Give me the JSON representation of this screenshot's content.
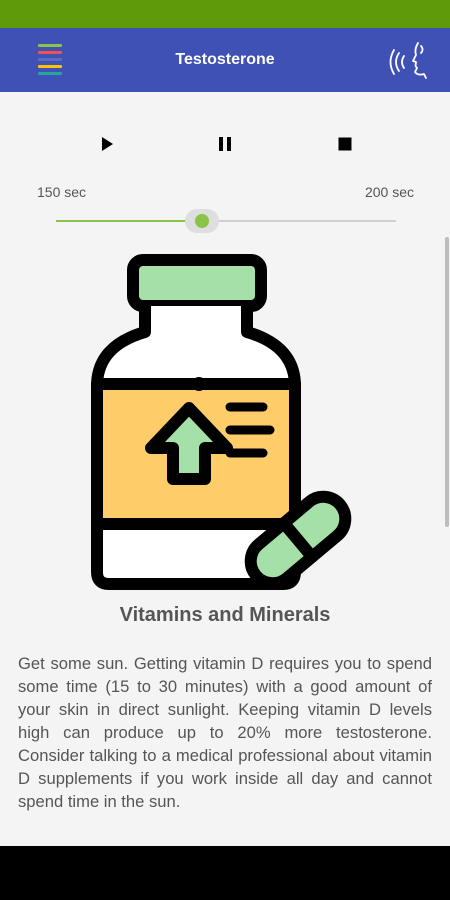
{
  "app": {
    "title": "Testosterone",
    "menu_icon": "hamburger-menu-icon",
    "voice_icon": "voice-speak-icon",
    "colors": {
      "status_bar": "#5e9a0a",
      "app_bar": "#3f51b5",
      "accent": "#8bc34a",
      "menu_stripes": [
        "#8bc34a",
        "#ef5350",
        "#3f51b5",
        "#ffc107",
        "#26a69a"
      ]
    }
  },
  "player": {
    "play_icon": "play-icon",
    "pause_icon": "pause-icon",
    "stop_icon": "stop-icon",
    "time_left": "150 sec",
    "time_right": "200 sec",
    "slider_progress": 0.43
  },
  "card": {
    "illustration": "supplement-bottle-with-pill-icon",
    "heading": "Vitamins and Minerals",
    "body": "Get some sun. Getting vitamin D requires you to spend some time (15 to 30 minutes) with a good amount of your skin in direct sunlight. Keeping vitamin D levels high can produce up to 20% more testosterone. Consider talking to a medical professional about vitamin D supplements if you work inside all day and cannot spend time in the sun."
  }
}
